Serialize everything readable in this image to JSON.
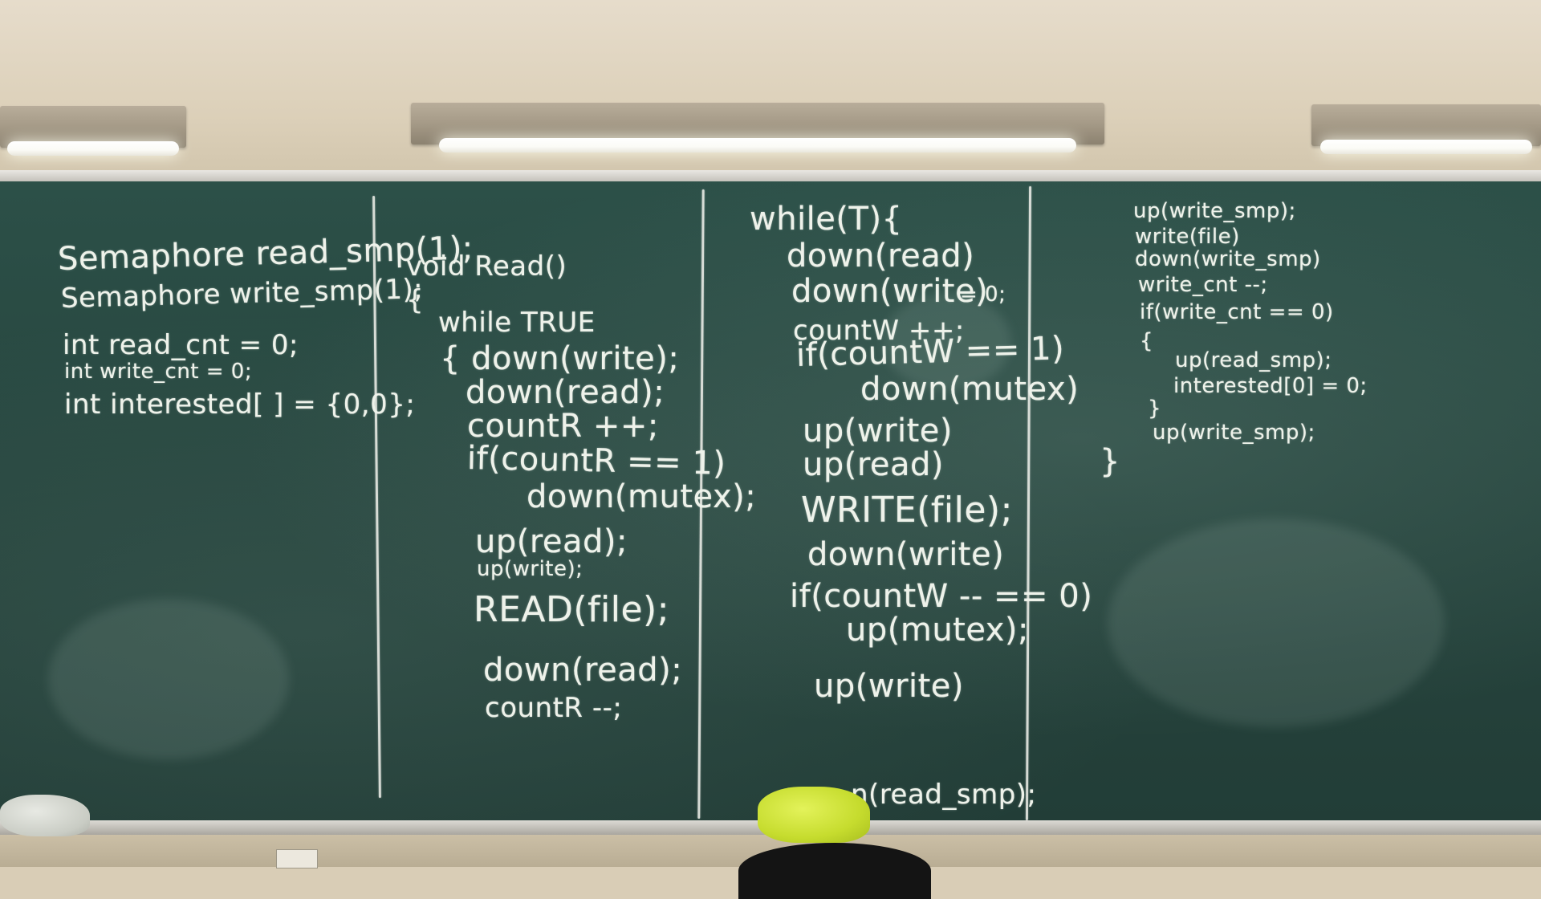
{
  "blackboard": {
    "col1": [
      "Semaphore  read_smp(1);",
      "Semaphore  write_smp(1);",
      "int  read_cnt = 0;",
      "int  write_cnt = 0;",
      "int  interested[ ] = {0,0};"
    ],
    "col2": [
      "void Read()",
      "{",
      "while TRUE",
      "{  down(write);",
      "down(read);",
      "countR ++;",
      "if(countR == 1)",
      "down(mutex);",
      "up(read);",
      "up(write);",
      "READ(file);",
      "down(read);",
      "countR --;"
    ],
    "col3": [
      "while(T){",
      "down(read)",
      "down(write)",
      "= 0;",
      "countW ++;",
      "if(countW == 1)",
      "down(mutex)",
      "up(write)",
      "up(read)",
      "WRITE(file);",
      "down(write)",
      "if(countW -- == 0)",
      "up(mutex);",
      "up(write)",
      "n(read_smp);"
    ],
    "col4": [
      "up(write_smp);",
      "write(file)",
      "down(write_smp)",
      "write_cnt --;",
      "if(write_cnt == 0)",
      "{",
      "up(read_smp);",
      "interested[0] = 0;",
      "}",
      "up(write_smp);",
      "}"
    ]
  }
}
